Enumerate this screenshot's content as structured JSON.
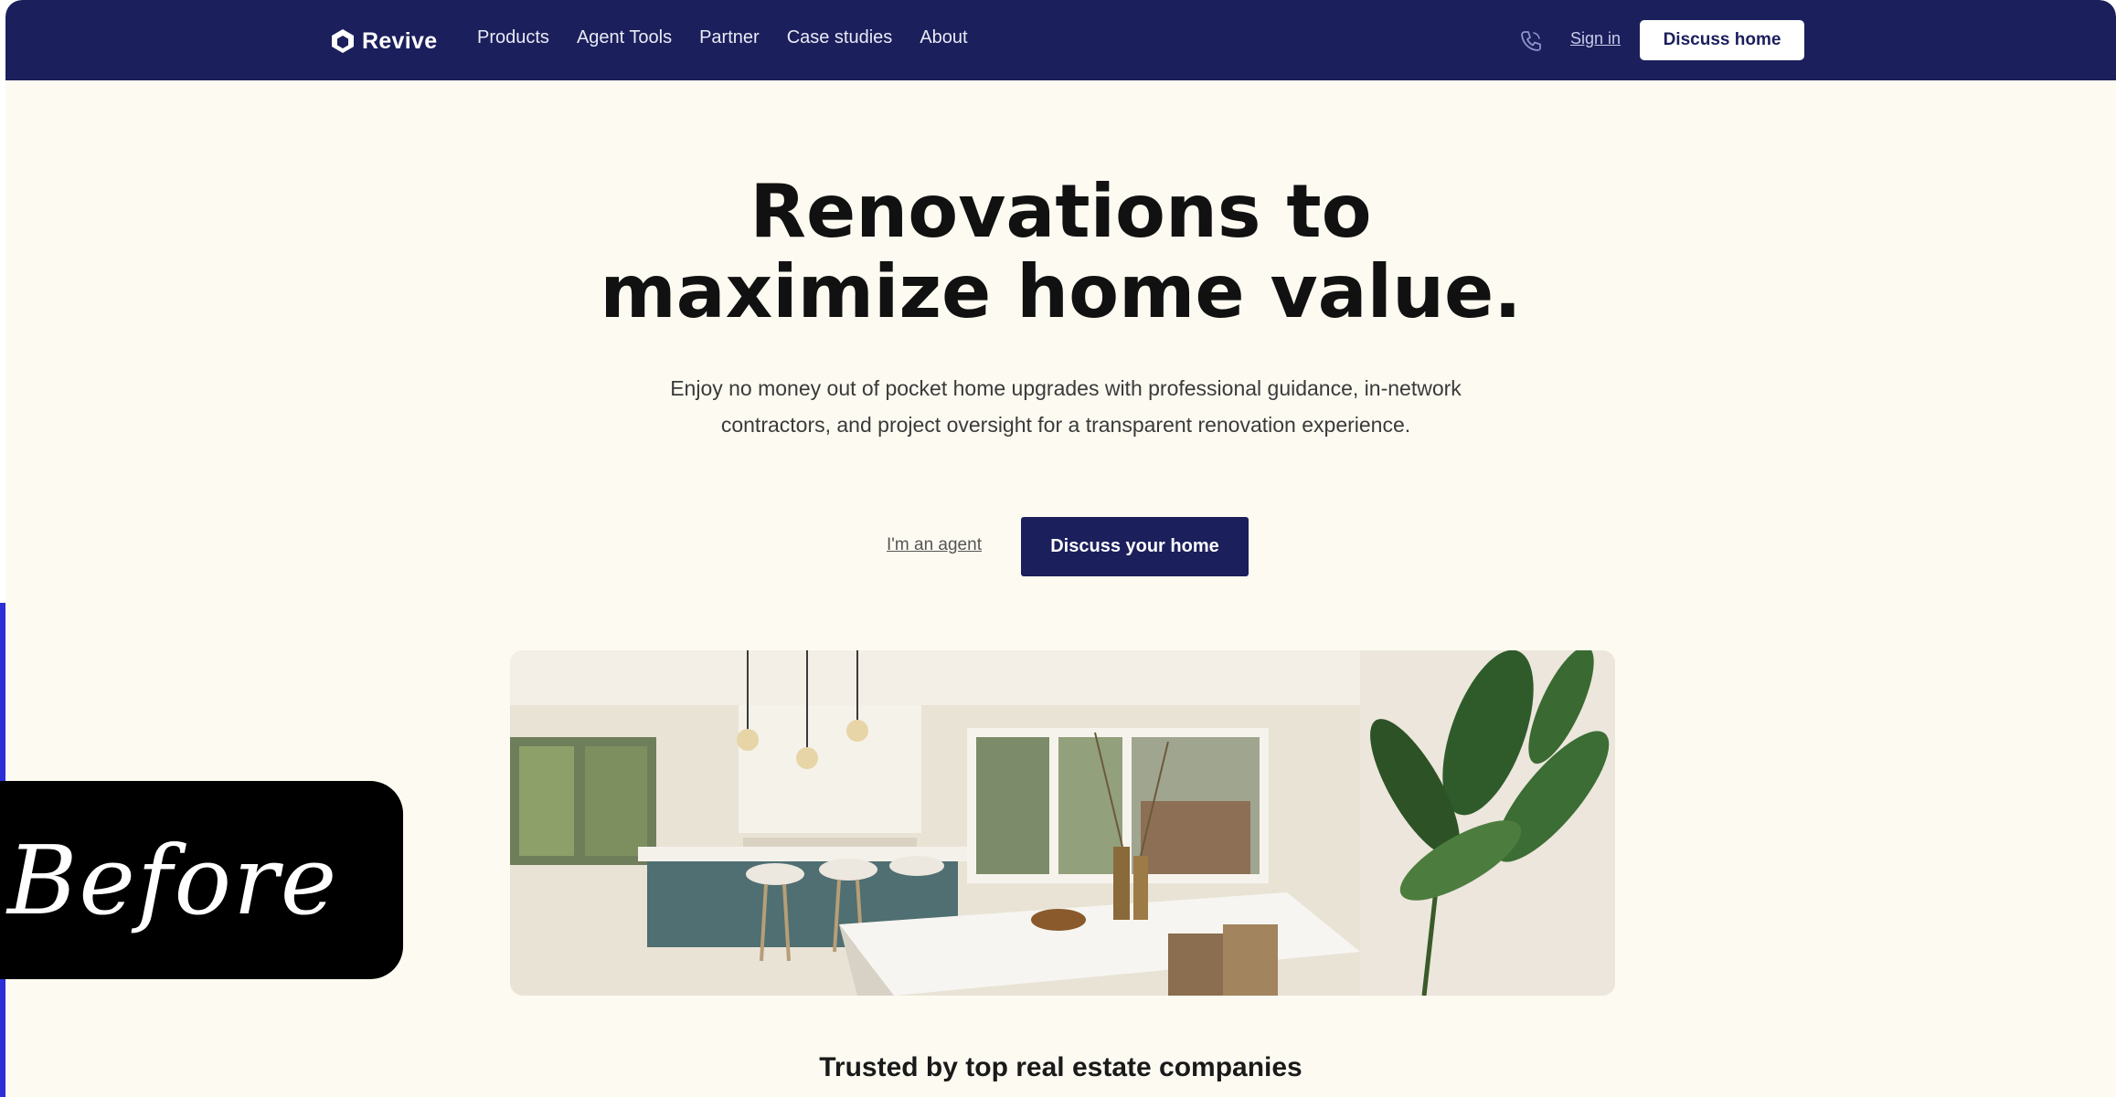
{
  "nav": {
    "brand": "Revive",
    "links": [
      "Products",
      "Agent Tools",
      "Partner",
      "Case studies",
      "About"
    ],
    "signin_label": "Sign in",
    "cta_label": "Discuss home"
  },
  "hero": {
    "title_line1": "Renovations to",
    "title_line2": "maximize home value.",
    "subtitle": "Enjoy no money out of pocket home upgrades with professional guidance, in-network contractors, and project oversight for a transparent renovation experience.",
    "agent_link": "I'm an agent",
    "cta_label": "Discuss your home"
  },
  "trusted": {
    "heading": "Trusted by top real estate companies"
  },
  "badge": {
    "label": "Before"
  },
  "icons": {
    "logo": "revive-logo-icon",
    "phone": "phone-icon"
  },
  "colors": {
    "nav_bg": "#1b1f5c",
    "page_bg": "#fdfbf1",
    "badge_bg": "#000000"
  }
}
